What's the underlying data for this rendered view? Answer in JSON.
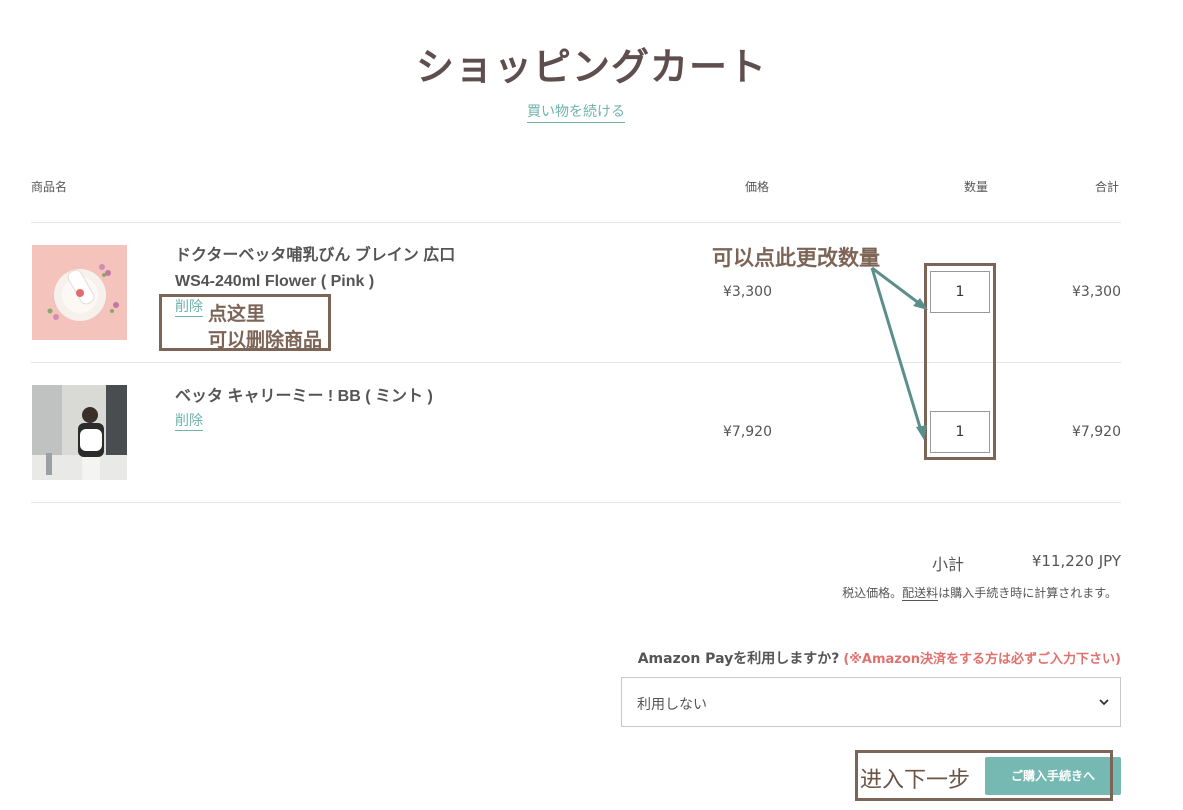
{
  "page": {
    "title": "ショッピングカート",
    "continue_shopping": "買い物を続ける"
  },
  "table": {
    "headers": {
      "product": "商品名",
      "price": "価格",
      "quantity": "数量",
      "total": "合計"
    }
  },
  "items": [
    {
      "name_line1": "ドクターベッタ哺乳びん ブレイン 広口",
      "name_line2": "WS4-240ml Flower ( Pink )",
      "remove": "削除",
      "price": "¥3,300",
      "quantity": "1",
      "total": "¥3,300"
    },
    {
      "name_line1": "ベッタ キャリーミー ! BB ( ミント )",
      "remove": "削除",
      "price": "¥7,920",
      "quantity": "1",
      "total": "¥7,920"
    }
  ],
  "summary": {
    "subtotal_label": "小計",
    "subtotal_value": "¥11,220 JPY",
    "tax_note_pre": "税込価格。",
    "shipping_link": "配送料",
    "tax_note_post": "は購入手続き時に計算されます。"
  },
  "amazon": {
    "question": "Amazon Payを利用しますか?",
    "warning": "(※Amazon決済をする方は必ずご入力下さい)",
    "select_value": "利用しない"
  },
  "checkout": {
    "label": "ご購入手続きへ"
  },
  "annotations": {
    "remove_hint_1": "点这里",
    "remove_hint_2": "可以删除商品",
    "quantity_hint": "可以点此更改数量",
    "next_step": "进入下一步"
  },
  "icons": {
    "select": "chevron-down-icon"
  },
  "colors": {
    "accent": "#76b9b2",
    "link": "#6fb3ad",
    "warning": "#e0716e",
    "annotation": "#7c6557",
    "title": "#5f4e4e"
  }
}
